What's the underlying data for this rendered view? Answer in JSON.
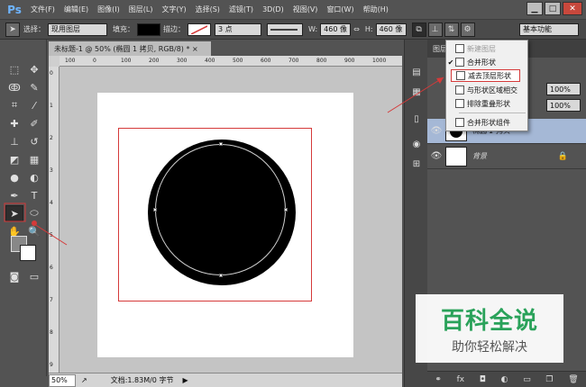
{
  "app": {
    "logo": "Ps",
    "menus": [
      "文件(F)",
      "编辑(E)",
      "图像(I)",
      "图层(L)",
      "文字(Y)",
      "选择(S)",
      "滤镜(T)",
      "3D(D)",
      "视图(V)",
      "窗口(W)",
      "帮助(H)"
    ],
    "window_controls": {
      "minimize": "▁",
      "maximize": "□",
      "close": "✕"
    }
  },
  "options": {
    "select_label": "选择：",
    "select_value": "现用图层",
    "fill_label": "填充：",
    "stroke_label": "描边：",
    "stroke_size": "3 点",
    "w_label": "W:",
    "w_value": "460 像",
    "h_label": "H:",
    "h_value": "460 像",
    "workspace": "基本功能"
  },
  "document": {
    "tab_title": "未标题-1 @ 50% (椭圆 1 拷贝, RGB/8) * ×",
    "ruler_h_labels": [
      "100",
      "0",
      "100",
      "200",
      "300",
      "400",
      "500",
      "600",
      "700",
      "800",
      "900",
      "1000"
    ],
    "ruler_v_labels": [
      "0",
      "1",
      "2",
      "3",
      "4",
      "5",
      "6",
      "7",
      "8",
      "9"
    ]
  },
  "status": {
    "zoom": "50%",
    "doc_info": "文档:1.83M/0 字节"
  },
  "layers": {
    "header": "图层",
    "zoom_a": "100%",
    "zoom_b": "100%",
    "rows": [
      {
        "name": "椭圆 1 拷贝",
        "selected": true
      },
      {
        "name": "背景",
        "selected": false
      }
    ],
    "footer_icons": [
      "link-icon",
      "fx-icon",
      "mask-icon",
      "adjust-icon",
      "folder-icon",
      "new-layer-icon",
      "trash-icon"
    ]
  },
  "path_ops_menu": {
    "items": [
      {
        "label": "新建图层",
        "disabled": true,
        "checked": false
      },
      {
        "label": "合并形状",
        "disabled": false,
        "checked": true
      },
      {
        "label": "减去顶层形状",
        "disabled": false,
        "checked": false,
        "highlighted": true
      },
      {
        "label": "与形状区域相交",
        "disabled": false,
        "checked": false
      },
      {
        "label": "排除重叠形状",
        "disabled": false,
        "checked": false
      },
      {
        "label": "合并形状组件",
        "disabled": false,
        "checked": false
      }
    ]
  },
  "watermark": {
    "title": "百科全说",
    "subtitle": "助你轻松解决"
  },
  "colors": {
    "annotation_red": "#d53a3a",
    "selected_layer": "#a5b8d6",
    "watermark_green": "#2aa25a"
  }
}
